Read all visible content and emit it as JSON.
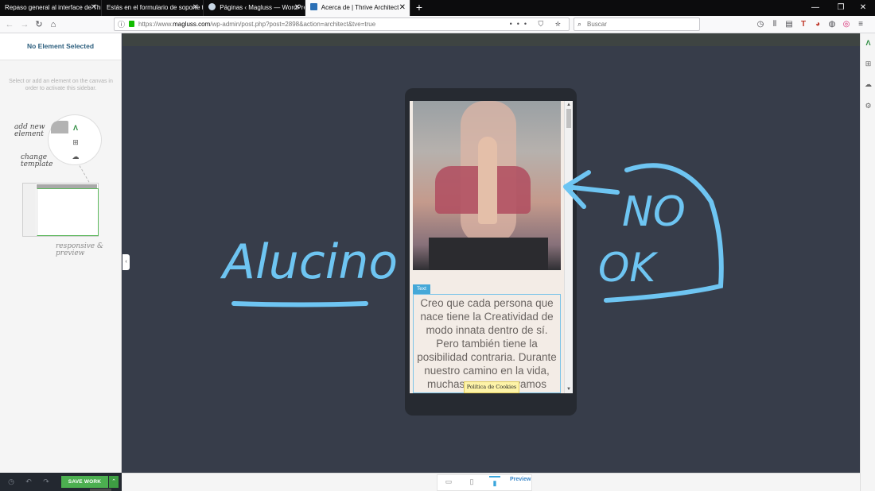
{
  "browser": {
    "tabs": [
      {
        "label": "Repaso general al interface de Thri",
        "close": "✕"
      },
      {
        "label": "Estás en el formulario de soporte té",
        "close": "✕"
      },
      {
        "label": "Páginas ‹ Magluss — WordPre",
        "close": "✕"
      },
      {
        "label": "Acerca de | Thrive Architect",
        "close": "✕"
      }
    ],
    "new_tab": "+",
    "url_prefix": "https://www.",
    "url_domain": "magluss.com",
    "url_path": "/wp-admin/post.php?post=2898&action=architect&tve=true",
    "url_actions": "••• ⛉ ☆",
    "search_placeholder": "Buscar",
    "window_controls": [
      "—",
      "❐",
      "✕"
    ],
    "nav": {
      "back": "←",
      "forward": "→",
      "reload": "↻",
      "home": "⌂",
      "info": "ⓘ"
    },
    "toolbar_icons": [
      "◷",
      "⫴",
      "▤",
      "T",
      "◕",
      "◍",
      "◎",
      "≡"
    ]
  },
  "sidebar": {
    "title": "No Element Selected",
    "help_text": "Select or add an element on the canvas in order to activate this sidebar.",
    "hint_add": "add new element",
    "hint_template": "change template",
    "hint_responsive": "responsive & preview",
    "icons": {
      "logo": "Λ",
      "add": "⊞",
      "cloud": "☁"
    }
  },
  "footer": {
    "save_label": "SAVE WORK",
    "save_arrow": "⌃",
    "history": "◷",
    "undo": "↶",
    "redo": "↷",
    "preview_label": "Preview",
    "devices": {
      "desktop": "▭",
      "tablet": "▯",
      "mobile": "▮"
    }
  },
  "canvas": {
    "collapse_label": "‹",
    "element_label": "Text",
    "body_text": "Creo que cada persona que nace tiene la Creatividad de modo innata dentro de sí. Pero también tiene la posibilidad contraria. Durante nuestro camino en la vida, muchas personas vamos",
    "cookie_text": "Política de Cookies",
    "scroll_up": "▲",
    "scroll_down": "▼"
  },
  "annotations": {
    "left_word": "Alucino",
    "right_word_1": "NO",
    "right_word_2": "OK",
    "stroke_color": "#6ec5f2"
  },
  "right_rail": {
    "logo": "Λ",
    "add": "⊞",
    "cloud": "☁",
    "settings": "⚙"
  },
  "colors": {
    "canvas": "#373d4a",
    "save": "#4caf50",
    "accent": "#45a8d8",
    "title": "#2d5f7e"
  }
}
